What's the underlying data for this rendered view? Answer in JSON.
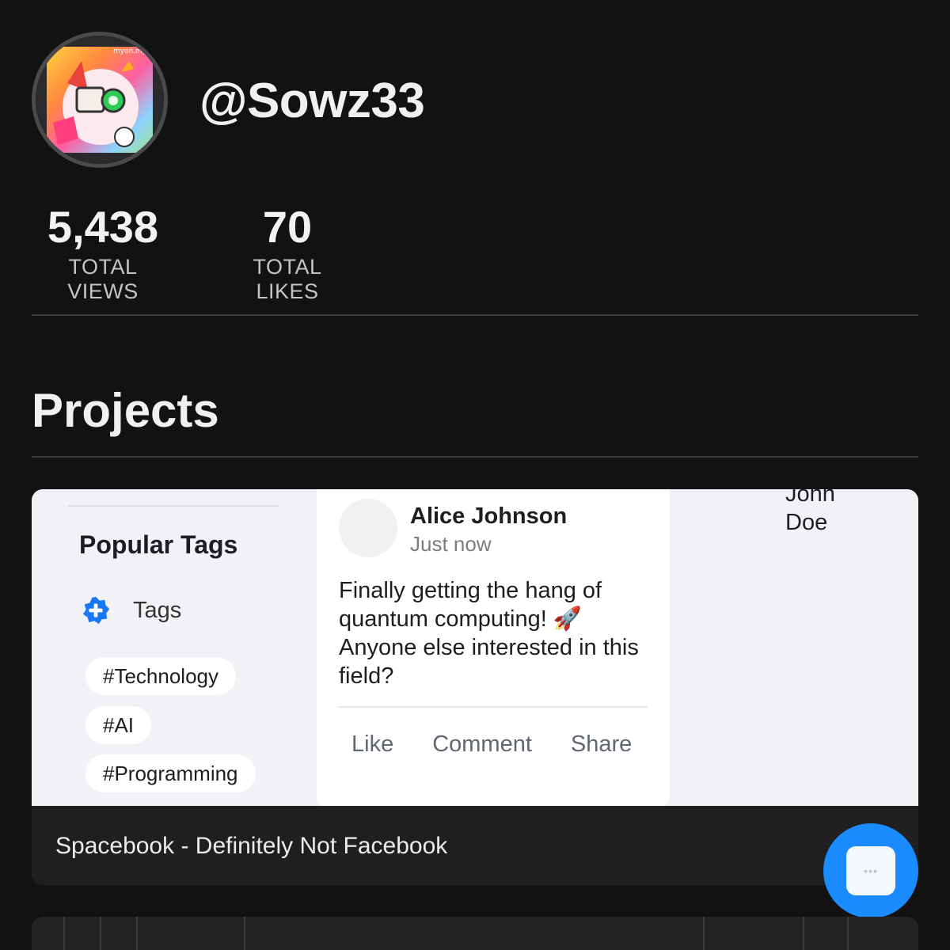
{
  "profile": {
    "username": "@Sowz33",
    "avatar_icon": "character-avatar"
  },
  "stats": {
    "views": {
      "value": "5,438",
      "label": "TOTAL VIEWS"
    },
    "likes": {
      "value": "70",
      "label": "TOTAL LIKES"
    }
  },
  "projects": {
    "heading": "Projects",
    "items": [
      {
        "title": "Spacebook - Definitely Not Facebook",
        "preview": {
          "sidebar": {
            "heading": "Popular Tags",
            "tags_label": "Tags",
            "tags_icon": "badge-plus-icon",
            "pills": [
              "#Technology",
              "#AI",
              "#Programming"
            ]
          },
          "post": {
            "author": "Alice Johnson",
            "time": "Just now",
            "text": "Finally getting the hang of quantum computing! 🚀 Anyone else interested in this field?",
            "actions": [
              "Like",
              "Comment",
              "Share"
            ]
          },
          "right_user": "John Doe"
        }
      }
    ]
  },
  "fab": {
    "icon": "more-icon",
    "label": "•••"
  },
  "colors": {
    "background": "#121213",
    "accent": "#1a8cff",
    "tag_icon": "#1877f2"
  }
}
